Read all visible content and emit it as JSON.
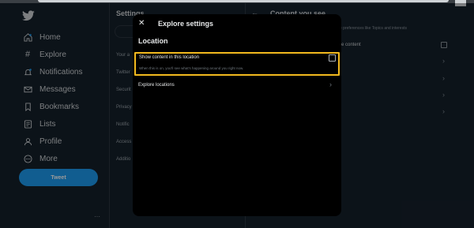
{
  "sidebar": {
    "items": [
      {
        "label": "Home",
        "icon": "home-icon"
      },
      {
        "label": "Explore",
        "icon": "hashtag-icon"
      },
      {
        "label": "Notifications",
        "icon": "bell-icon"
      },
      {
        "label": "Messages",
        "icon": "envelope-icon"
      },
      {
        "label": "Bookmarks",
        "icon": "bookmark-icon"
      },
      {
        "label": "Lists",
        "icon": "list-icon"
      },
      {
        "label": "Profile",
        "icon": "person-icon"
      },
      {
        "label": "More",
        "icon": "more-circle-icon"
      }
    ],
    "tweet_label": "Tweet",
    "more_dots": "···"
  },
  "settings": {
    "title": "Settings",
    "rows": [
      "Your a",
      "Twitter",
      "Securit",
      "Privacy",
      "Notific",
      "Access",
      "Additio"
    ]
  },
  "content_you_see": {
    "title": "Content you see",
    "description": "e preferences like Topics and interests",
    "item_label": "e content"
  },
  "modal": {
    "close_glyph": "✕",
    "title": "Explore settings",
    "section_title": "Location",
    "option_label": "Show content in this location",
    "option_description": "When this is on, you'll see what's happening around you right now.",
    "explore_locations_label": "Explore locations",
    "chevron_glyph": "›"
  },
  "colors": {
    "background": "#15202b",
    "accent": "#1d9bf0",
    "highlight": "#f2b91e",
    "modal_bg": "#000000"
  }
}
